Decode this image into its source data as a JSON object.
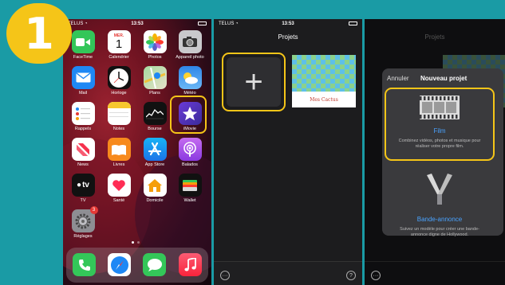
{
  "step_number": "1",
  "colors": {
    "accent_highlight": "#f5c518",
    "link_blue": "#4aa3ff",
    "frame_teal": "#1a9ba5"
  },
  "home": {
    "status": {
      "carrier": "TELUS",
      "time": "13:53"
    },
    "calendar": {
      "weekday": "MER.",
      "day": "1"
    },
    "apps": [
      {
        "name": "facetime",
        "label": "FaceTime",
        "icon": "video-icon"
      },
      {
        "name": "calendar",
        "label": "Calendrier",
        "icon": "calendar-icon"
      },
      {
        "name": "photos",
        "label": "Photos",
        "icon": "photos-icon"
      },
      {
        "name": "camera",
        "label": "Appareil photo",
        "icon": "camera-icon"
      },
      {
        "name": "mail",
        "label": "Mail",
        "icon": "mail-icon"
      },
      {
        "name": "clock",
        "label": "Horloge",
        "icon": "clock-icon"
      },
      {
        "name": "maps",
        "label": "Plans",
        "icon": "map-icon"
      },
      {
        "name": "weather",
        "label": "Météo",
        "icon": "weather-icon"
      },
      {
        "name": "reminders",
        "label": "Rappels",
        "icon": "list-icon"
      },
      {
        "name": "notes",
        "label": "Notes",
        "icon": "notes-icon"
      },
      {
        "name": "stocks",
        "label": "Bourse",
        "icon": "chart-icon"
      },
      {
        "name": "imovie",
        "label": "iMovie",
        "icon": "star-icon"
      },
      {
        "name": "news",
        "label": "News",
        "icon": "news-icon"
      },
      {
        "name": "books",
        "label": "Livres",
        "icon": "book-icon"
      },
      {
        "name": "appstore",
        "label": "App Store",
        "icon": "appstore-icon"
      },
      {
        "name": "podcasts",
        "label": "Balados",
        "icon": "podcast-icon"
      },
      {
        "name": "tv",
        "label": "TV",
        "icon": "tv-icon"
      },
      {
        "name": "health",
        "label": "Santé",
        "icon": "heart-icon"
      },
      {
        "name": "home",
        "label": "Domicile",
        "icon": "house-icon"
      },
      {
        "name": "wallet",
        "label": "Wallet",
        "icon": "wallet-icon"
      },
      {
        "name": "settings",
        "label": "Réglages",
        "icon": "gear-icon",
        "badge": "3"
      }
    ],
    "tv_glyph": "tv",
    "dock": [
      "phone-icon",
      "safari-icon",
      "messages-icon",
      "music-icon"
    ]
  },
  "projects": {
    "title": "Projets",
    "new_glyph": "+",
    "project_caption": "Mes Cactus",
    "bottom_left_glyph": "···",
    "bottom_right_glyph": "?"
  },
  "new_project": {
    "background_title": "Projets",
    "cancel_label": "Annuler",
    "title": "Nouveau projet",
    "film": {
      "title": "Film",
      "description": "Combinez vidéos, photos et musique pour réaliser votre propre film."
    },
    "trailer": {
      "title": "Bande-annonce",
      "description": "Suivez un modèle pour créer une bande-annonce digne de Hollywood."
    }
  }
}
